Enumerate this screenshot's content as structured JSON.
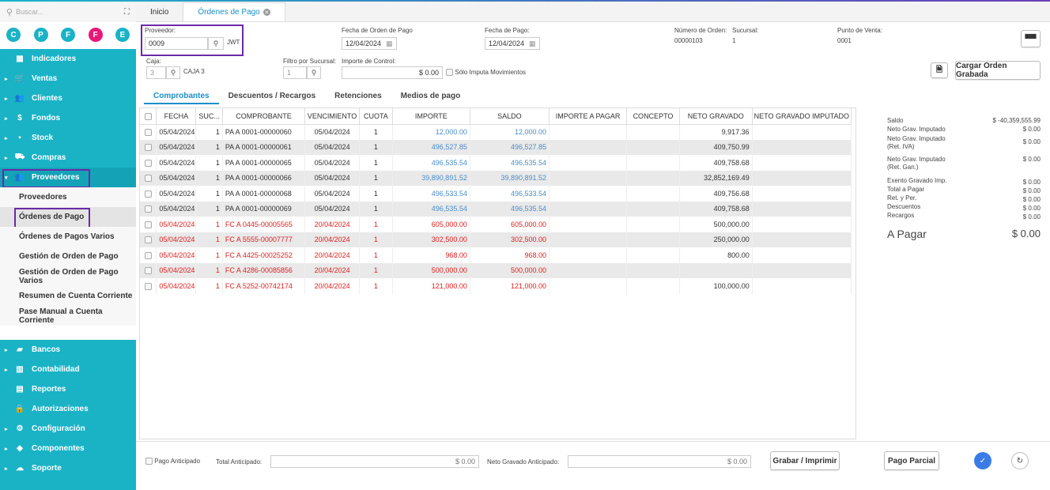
{
  "sidebar": {
    "search_placeholder": "Buscar...",
    "circles": [
      {
        "letter": "C",
        "color": "#1ab3c6"
      },
      {
        "letter": "P",
        "color": "#1ab3c6"
      },
      {
        "letter": "F",
        "color": "#1ab3c6"
      },
      {
        "letter": "F",
        "color": "#e8187a"
      },
      {
        "letter": "E",
        "color": "#1ab3c6"
      }
    ],
    "menu_top": [
      {
        "label": "Indicadores",
        "icon": "▦",
        "caret": ""
      },
      {
        "label": "Ventas",
        "icon": "🛒",
        "caret": "▸"
      },
      {
        "label": "Clientes",
        "icon": "👥",
        "caret": "▸"
      },
      {
        "label": "Fondos",
        "icon": "$",
        "caret": "▸"
      },
      {
        "label": "Stock",
        "icon": "▪",
        "caret": "▸"
      },
      {
        "label": "Compras",
        "icon": "⛟",
        "caret": "▸"
      },
      {
        "label": "Proveedores",
        "icon": "👥",
        "caret": "▾"
      }
    ],
    "submenu": [
      "Proveedores",
      "Órdenes de Pago",
      "Órdenes de Pagos Varios",
      "Gestión de Orden de Pago",
      "Gestión de Orden de Pago Varios",
      "Resumen de Cuenta Corriente",
      "Pase Manual a Cuenta Corriente"
    ],
    "menu_bottom": [
      {
        "label": "Bancos",
        "icon": "▰",
        "caret": "▸"
      },
      {
        "label": "Contabilidad",
        "icon": "▥",
        "caret": "▸"
      },
      {
        "label": "Reportes",
        "icon": "▤",
        "caret": ""
      },
      {
        "label": "Autorizaciones",
        "icon": "🔒",
        "caret": ""
      },
      {
        "label": "Configuración",
        "icon": "⚙",
        "caret": "▸"
      },
      {
        "label": "Componentes",
        "icon": "◆",
        "caret": "▸"
      },
      {
        "label": "Soporte",
        "icon": "☁",
        "caret": "▸"
      }
    ]
  },
  "tabs": {
    "inicio": "Inicio",
    "ordenes": "Órdenes de Pago"
  },
  "form": {
    "proveedor_label": "Proveedor:",
    "proveedor_value": "0009",
    "proveedor_name": "JWT",
    "fecha_orden_label": "Fecha de Orden de Pago",
    "fecha_orden_value": "12/04/2024",
    "fecha_pago_label": "Fecha de Pago:",
    "fecha_pago_value": "12/04/2024",
    "numero_orden_label": "Número de Orden:",
    "numero_orden_value": "00000103",
    "sucursal_label": "Sucursal:",
    "sucursal_value": "1",
    "punto_venta_label": "Punto de Venta:",
    "punto_venta_value": "0001",
    "caja_label": "Caja:",
    "caja_value": "3",
    "caja_name": "CAJA 3",
    "filtro_label": "Filtro por Sucursal:",
    "filtro_value": "1",
    "importe_control_label": "Importe de Control:",
    "importe_control_value": "$ 0.00",
    "solo_imputa_label": "Sólo Imputa Movimientos",
    "cargar_orden_label": "Cargar Orden Grabada"
  },
  "inner_tabs": [
    "Comprobantes",
    "Descuentos / Recargos",
    "Retenciones",
    "Medios de pago"
  ],
  "table": {
    "columns": [
      "FECHA",
      "SUC...",
      "COMPROBANTE",
      "VENCIMIENTO",
      "CUOTA",
      "IMPORTE",
      "SALDO",
      "IMPORTE A PAGAR",
      "CONCEPTO",
      "NETO GRAVADO",
      "NETO GRAVADO IMPUTADO"
    ],
    "rows": [
      {
        "fecha": "05/04/2024",
        "suc": "1",
        "comprobante": "PA A 0001-00000060",
        "venc": "05/04/2024",
        "cuota": "1",
        "importe": "12,000.00",
        "saldo": "12,000.00",
        "neto": "9,917.36",
        "red": false
      },
      {
        "fecha": "05/04/2024",
        "suc": "1",
        "comprobante": "PA A 0001-00000061",
        "venc": "05/04/2024",
        "cuota": "1",
        "importe": "496,527.85",
        "saldo": "496,527.85",
        "neto": "409,750.99",
        "red": false
      },
      {
        "fecha": "05/04/2024",
        "suc": "1",
        "comprobante": "PA A 0001-00000065",
        "venc": "05/04/2024",
        "cuota": "1",
        "importe": "496,535.54",
        "saldo": "496,535.54",
        "neto": "409,758.68",
        "red": false
      },
      {
        "fecha": "05/04/2024",
        "suc": "1",
        "comprobante": "PA A 0001-00000066",
        "venc": "05/04/2024",
        "cuota": "1",
        "importe": "39,890,891.52",
        "saldo": "39,890,891.52",
        "neto": "32,852,169.49",
        "red": false
      },
      {
        "fecha": "05/04/2024",
        "suc": "1",
        "comprobante": "PA A 0001-00000068",
        "venc": "05/04/2024",
        "cuota": "1",
        "importe": "496,533.54",
        "saldo": "496,533.54",
        "neto": "409,756.68",
        "red": false
      },
      {
        "fecha": "05/04/2024",
        "suc": "1",
        "comprobante": "PA A 0001-00000069",
        "venc": "05/04/2024",
        "cuota": "1",
        "importe": "496,535.54",
        "saldo": "496,535.54",
        "neto": "409,758.68",
        "red": false
      },
      {
        "fecha": "05/04/2024",
        "suc": "1",
        "comprobante": "FC A 0445-00005565",
        "venc": "20/04/2024",
        "cuota": "1",
        "importe": "605,000.00",
        "saldo": "605,000.00",
        "neto": "500,000.00",
        "red": true
      },
      {
        "fecha": "05/04/2024",
        "suc": "1",
        "comprobante": "FC A 5555-00007777",
        "venc": "20/04/2024",
        "cuota": "1",
        "importe": "302,500.00",
        "saldo": "302,500.00",
        "neto": "250,000.00",
        "red": true
      },
      {
        "fecha": "05/04/2024",
        "suc": "1",
        "comprobante": "FC A 4425-00025252",
        "venc": "20/04/2024",
        "cuota": "1",
        "importe": "968.00",
        "saldo": "968.00",
        "neto": "800.00",
        "red": true
      },
      {
        "fecha": "05/04/2024",
        "suc": "1",
        "comprobante": "FC A 4286-00085856",
        "venc": "20/04/2024",
        "cuota": "1",
        "importe": "500,000.00",
        "saldo": "500,000.00",
        "neto": "",
        "red": true
      },
      {
        "fecha": "05/04/2024",
        "suc": "1",
        "comprobante": "FC A 5252-00742174",
        "venc": "20/04/2024",
        "cuota": "1",
        "importe": "121,000.00",
        "saldo": "121,000.00",
        "neto": "100,000.00",
        "red": true
      }
    ]
  },
  "summary": {
    "items": [
      {
        "label": "Saldo",
        "value": "$ -40,359,555.99"
      },
      {
        "label": "Neto Grav. Imputado",
        "value": "$ 0.00"
      },
      {
        "label": "Neto Grav. Imputado (Ret. IVA)",
        "value": "$ 0.00"
      },
      {
        "label": "Neto Grav. Imputado (Ret. Gan.)",
        "value": "$ 0.00"
      },
      {
        "label": "Exento Gravado Imp.",
        "value": "$ 0.00"
      },
      {
        "label": "Total a Pagar",
        "value": "$ 0.00"
      },
      {
        "label": "Ret. y Per.",
        "value": "$ 0.00"
      },
      {
        "label": "Descuentos",
        "value": "$ 0.00"
      },
      {
        "label": "Recargos",
        "value": "$ 0.00"
      }
    ],
    "a_pagar_label": "A Pagar",
    "a_pagar_value": "$ 0.00"
  },
  "footer": {
    "pago_anticipado_label": "Pago Anticipado",
    "total_anticipado_label": "Total Anticipado:",
    "total_anticipado_value": "$ 0.00",
    "neto_anticipado_label": "Neto Gravado Anticipado:",
    "neto_anticipado_value": "$ 0.00",
    "grabar_label": "Grabar / Imprimir",
    "pago_parcial_label": "Pago Parcial"
  },
  "colors": {
    "accent": "#1ab3c6",
    "link": "#1a8fc9",
    "highlight": "#6a2aa8",
    "danger": "#e32020",
    "confirm": "#3b7be8"
  }
}
